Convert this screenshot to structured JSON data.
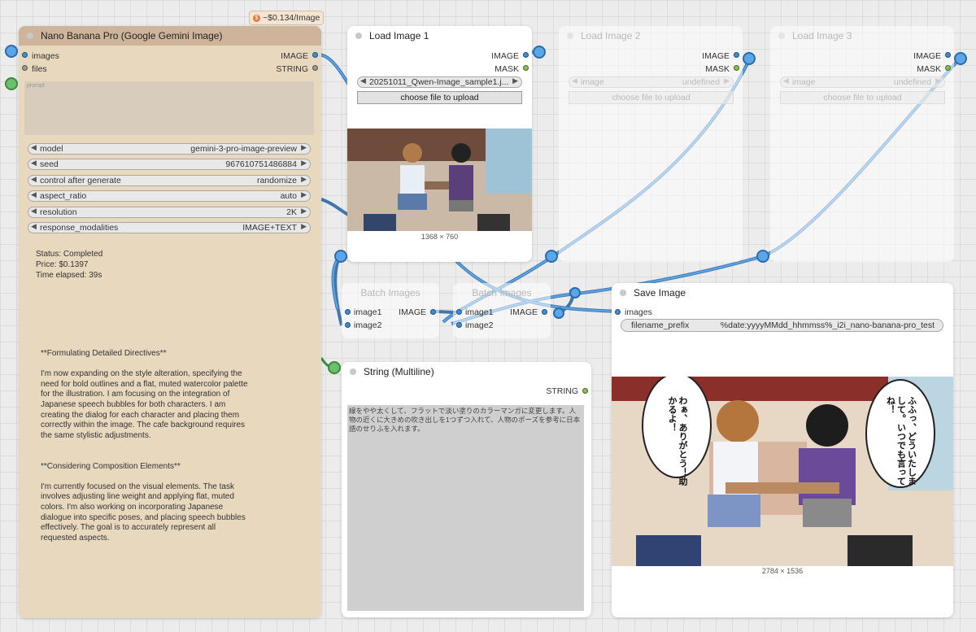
{
  "cost_badge": "~$0.134/Image",
  "nano": {
    "title": "Nano Banana Pro (Google Gemini Image)",
    "inputs": [
      "images",
      "files"
    ],
    "outputs": [
      "IMAGE",
      "STRING"
    ],
    "prompt_placeholder": "prompt",
    "widgets": [
      {
        "label": "model",
        "value": "gemini-3-pro-image-preview"
      },
      {
        "label": "seed",
        "value": "967610751486884"
      },
      {
        "label": "control after generate",
        "value": "randomize"
      },
      {
        "label": "aspect_ratio",
        "value": "auto"
      },
      {
        "label": "resolution",
        "value": "2K"
      },
      {
        "label": "response_modalities",
        "value": "IMAGE+TEXT"
      }
    ],
    "status": "Status: Completed",
    "price": "Price: $0.1397",
    "elapsed": "Time elapsed: 39s",
    "thoughts": "**Formulating Detailed Directives**\n\nI'm now expanding on the style alteration, specifying the need for bold outlines and a flat, muted watercolor palette for the illustration. I am focusing on the integration of Japanese speech bubbles for both characters. I am creating the dialog for each character and placing them correctly within the image. The cafe background requires the same stylistic adjustments.\n\n\n**Considering Composition Elements**\n\nI'm currently focused on the visual elements. The task involves adjusting line weight and applying flat, muted colors. I'm also working on incorporating Japanese dialogue into specific poses, and placing speech bubbles effectively. The goal is to accurately represent all requested aspects."
  },
  "load1": {
    "title": "Load Image 1",
    "outputs": [
      "IMAGE",
      "MASK"
    ],
    "image_value": "20251011_Qwen-Image_sample1.j...",
    "upload_label": "choose file to upload",
    "dims": "1368 × 760"
  },
  "load2": {
    "title": "Load Image 2",
    "outputs": [
      "IMAGE",
      "MASK"
    ],
    "image_label": "image",
    "image_value": "undefined",
    "upload_label": "choose file to upload"
  },
  "load3": {
    "title": "Load Image 3",
    "outputs": [
      "IMAGE",
      "MASK"
    ],
    "image_label": "image",
    "image_value": "undefined",
    "upload_label": "choose file to upload"
  },
  "batch1": {
    "title": "Batch Images",
    "inputs": [
      "image1",
      "image2"
    ],
    "output": "IMAGE"
  },
  "batch2": {
    "title": "Batch Images",
    "inputs": [
      "image1",
      "image2"
    ],
    "output": "IMAGE"
  },
  "string_node": {
    "title": "String (Multiline)",
    "output": "STRING",
    "text": "線をやや太くして、フラットで淡い塗りのカラーマンガに変更します。人物の近くに大きめの吹き出しを1つずつ入れて、人物のポーズを参考に日本語のせりふを入れます。"
  },
  "save": {
    "title": "Save Image",
    "input": "images",
    "prefix_label": "filename_prefix",
    "prefix_value": "%date:yyyyMMdd_hhmmss%_i2i_nano-banana-pro_test",
    "dims": "2784 × 1536",
    "bubble_left": "わぁ、ありがとう！助かるよ！",
    "bubble_right": "ふふっ、どういたしまして。いつでも言ってね！"
  },
  "colors": {
    "wire": "#4a8fd0",
    "nano_header": "#cdb49a",
    "nano_body": "#e8d8be"
  }
}
